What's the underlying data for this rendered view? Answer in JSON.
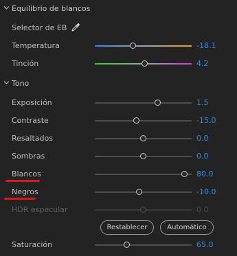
{
  "white_balance": {
    "title": "Equilibrio de blancos",
    "selector_label": "Selector de EB",
    "eyedropper_icon": "eyedropper-icon",
    "sliders": [
      {
        "key": "temperatura",
        "label": "Temperatura",
        "value": "-18.1",
        "level": 0.4
      },
      {
        "key": "tincion",
        "label": "Tinción",
        "value": "4.2",
        "level": 0.52
      }
    ]
  },
  "tone": {
    "title": "Tono",
    "sliders": [
      {
        "key": "exposicion",
        "label": "Exposición",
        "value": "1.5",
        "level": 0.65
      },
      {
        "key": "contraste",
        "label": "Contraste",
        "value": "-15.0",
        "level": 0.43
      },
      {
        "key": "resaltados",
        "label": "Resaltados",
        "value": "0.0",
        "level": 0.5
      },
      {
        "key": "sombras",
        "label": "Sombras",
        "value": "0.0",
        "level": 0.5
      },
      {
        "key": "blancos",
        "label": "Blancos",
        "value": "80.0",
        "level": 0.93
      },
      {
        "key": "negros",
        "label": "Negros",
        "value": "-10.0",
        "level": 0.46
      },
      {
        "key": "hdr",
        "label": "HDR especular",
        "value": "0.0",
        "level": 0.5,
        "disabled": true
      }
    ],
    "reset_label": "Restablecer",
    "auto_label": "Automático"
  },
  "saturation": {
    "label": "Saturación",
    "value": "65.0",
    "level": 0.33
  },
  "colors": {
    "accent": "#2d8ceb",
    "annotation": "#d91a1a",
    "background": "#232323"
  }
}
